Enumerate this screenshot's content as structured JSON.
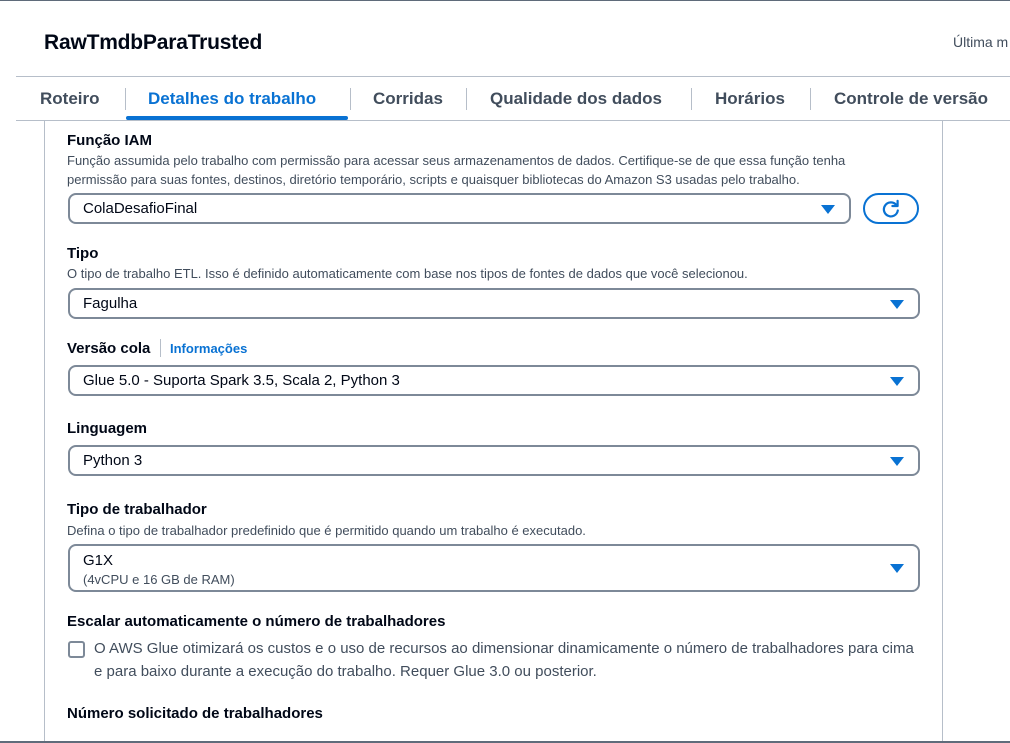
{
  "header": {
    "job_title": "RawTmdbParaTrusted",
    "last_modified_label": "Última m"
  },
  "tabs": [
    {
      "label": "Roteiro",
      "active": false
    },
    {
      "label": "Detalhes do trabalho",
      "active": true
    },
    {
      "label": "Corridas",
      "active": false
    },
    {
      "label": "Qualidade dos dados",
      "active": false
    },
    {
      "label": "Horários",
      "active": false
    },
    {
      "label": "Controle de versão",
      "active": false
    }
  ],
  "form": {
    "iam_role": {
      "label": "Função IAM",
      "description": "Função assumida pelo trabalho com permissão para acessar seus armazenamentos de dados. Certifique-se de que essa função tenha permissão para suas fontes, destinos, diretório temporário, scripts e quaisquer bibliotecas do Amazon S3 usadas pelo trabalho.",
      "value": "ColaDesafioFinal",
      "refresh_icon": "refresh-icon"
    },
    "type": {
      "label": "Tipo",
      "description": "O tipo de trabalho ETL. Isso é definido automaticamente com base nos tipos de fontes de dados que você selecionou.",
      "value": "Fagulha"
    },
    "glue_version": {
      "label": "Versão cola",
      "info_link": "Informações",
      "value": "Glue 5.0 - Suporta Spark 3.5, Scala 2, Python 3"
    },
    "language": {
      "label": "Linguagem",
      "value": "Python 3"
    },
    "worker_type": {
      "label": "Tipo de trabalhador",
      "description": "Defina o tipo de trabalhador predefinido que é permitido quando um trabalho é executado.",
      "value": "G1X",
      "sub_value": "(4vCPU e 16 GB de RAM)"
    },
    "autoscale": {
      "label": "Escalar automaticamente o número de trabalhadores",
      "checkbox_text": "O AWS Glue otimizará os custos e o uso de recursos ao dimensionar dinamicamente o número de trabalhadores para cima e para baixo durante a execução do trabalho. Requer Glue 3.0 ou posterior.",
      "checked": false
    },
    "requested_workers": {
      "label": "Número solicitado de trabalhadores"
    }
  },
  "colors": {
    "accent": "#0972d3",
    "text": "#000716",
    "muted": "#414d5c",
    "border": "#7d8998"
  }
}
